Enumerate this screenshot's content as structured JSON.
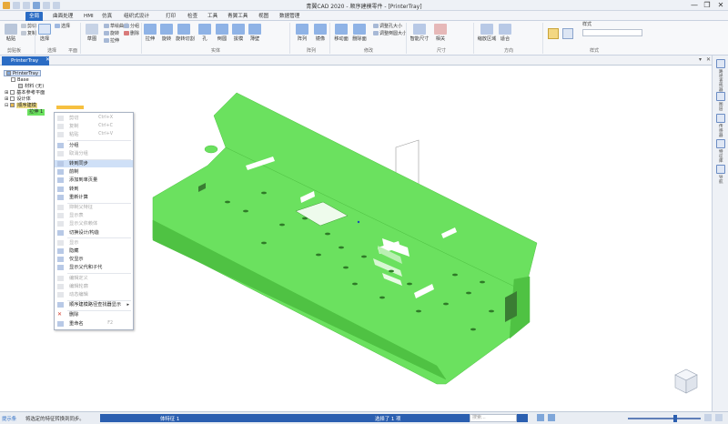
{
  "window": {
    "title": "青翼CAD 2020 - 顺序建模零件 - [PrinterTray]",
    "controls": [
      "—",
      "❐",
      "✕"
    ]
  },
  "tabs": [
    "全局",
    "曲面处理",
    "HMI",
    "仿真",
    "组织式设计",
    "打印",
    "检查",
    "工具",
    "青翼工具",
    "视图",
    "数据管理"
  ],
  "ribbon": {
    "big_buttons": [
      "粘贴",
      "选择",
      "草图",
      "拉伸",
      "旋转",
      "旋转切割",
      "孔",
      "倒圆",
      "拔模",
      "薄壁",
      "阵列",
      "镜像",
      "移动面",
      "删除面",
      "智能尺寸",
      "相关",
      "缩放区域",
      "适合"
    ],
    "small_buttons": {
      "clipboard": [
        "剪切",
        "复制"
      ],
      "sketch": [
        "草绘曲线"
      ],
      "select": [
        "选择"
      ],
      "shape": [
        "旋转",
        "拉伸"
      ],
      "modify": [
        "调整孔大小",
        "调整倒圆大小"
      ],
      "paste_right": [
        "分组",
        "删除"
      ]
    },
    "groups": [
      "剪贴板",
      "选择",
      "平面",
      "实体",
      "阵列",
      "修改",
      "尺寸",
      "方向",
      "样式"
    ],
    "style_label": "样式",
    "style_value": ""
  },
  "doc_tab": {
    "label": "PrinterTray"
  },
  "tree": {
    "items": [
      {
        "label": "PrinterTray"
      },
      {
        "label": "Base"
      },
      {
        "label": "材料 (无)"
      },
      {
        "label": "基本参考平面"
      },
      {
        "label": "设计体"
      },
      {
        "label": "顺序建模"
      },
      {
        "label": "拉伸 1"
      }
    ]
  },
  "context_menu": {
    "items": [
      {
        "label": "剪切",
        "shortcut": "Ctrl+X",
        "disabled": true
      },
      {
        "label": "复制",
        "shortcut": "Ctrl+C",
        "disabled": true
      },
      {
        "label": "粘贴",
        "shortcut": "Ctrl+V",
        "disabled": true
      },
      {
        "label": "分组",
        "shortcut": "",
        "disabled": false
      },
      {
        "label": "取消分组",
        "shortcut": "",
        "disabled": true
      },
      {
        "label": "转到同步",
        "shortcut": "",
        "disabled": false,
        "highlight": true
      },
      {
        "label": "前制",
        "shortcut": "",
        "disabled": false
      },
      {
        "label": "添加到单页量",
        "shortcut": "",
        "disabled": false
      },
      {
        "label": "转到",
        "shortcut": "",
        "disabled": false
      },
      {
        "label": "重新计算",
        "shortcut": "",
        "disabled": false
      },
      {
        "label": "抑制父特征",
        "shortcut": "",
        "disabled": true
      },
      {
        "label": "显示表",
        "shortcut": "",
        "disabled": true
      },
      {
        "label": "显示父依赖体",
        "shortcut": "",
        "disabled": true
      },
      {
        "label": "切换设计/构造",
        "shortcut": "",
        "disabled": false
      },
      {
        "label": "显示",
        "shortcut": "",
        "disabled": true
      },
      {
        "label": "隐藏",
        "shortcut": "",
        "disabled": false
      },
      {
        "label": "仅显示",
        "shortcut": "",
        "disabled": false
      },
      {
        "label": "显示父代和子代",
        "shortcut": "",
        "disabled": false
      },
      {
        "label": "编辑定义",
        "shortcut": "",
        "disabled": true
      },
      {
        "label": "编辑轮廓",
        "shortcut": "",
        "disabled": true
      },
      {
        "label": "动态编辑",
        "shortcut": "",
        "disabled": true
      },
      {
        "label": "顺序建模路径查找器显示",
        "shortcut": "",
        "disabled": false,
        "submenu": true
      },
      {
        "label": "删除",
        "shortcut": "",
        "disabled": false
      },
      {
        "label": "重命名",
        "shortcut": "F2",
        "disabled": false
      }
    ]
  },
  "right_panel": {
    "labels": [
      "路径查找器",
      "图层",
      "传感器",
      "特征库",
      "导航"
    ]
  },
  "status": {
    "prompt_label": "提示条",
    "prompt_text": "将选定的特征转换到同步。",
    "feature_count": "选择了 1 项",
    "selection": "体特征 1",
    "search_placeholder": "搜索...",
    "colors": {
      "part": "#6be15f",
      "part_shadow": "#4fc243",
      "accent": "#2b6cc4"
    }
  }
}
